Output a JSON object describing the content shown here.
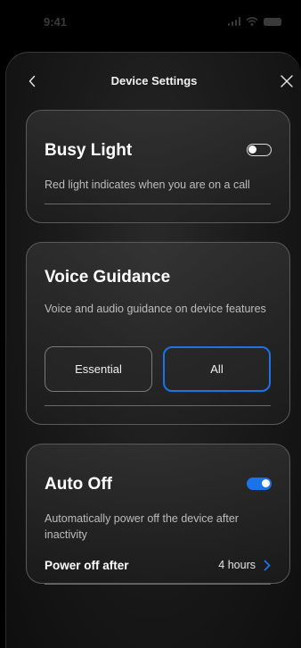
{
  "status_bar": {
    "time": "9:41"
  },
  "nav": {
    "title": "Device Settings"
  },
  "busy_light": {
    "title": "Busy Light",
    "description": "Red light indicates when you are on a call",
    "enabled": false
  },
  "voice_guidance": {
    "title": "Voice Guidance",
    "description": "Voice and audio guidance on device features",
    "options": [
      {
        "label": "Essential",
        "selected": false
      },
      {
        "label": "All",
        "selected": true
      }
    ]
  },
  "auto_off": {
    "title": "Auto Off",
    "description": "Automatically power off the device after inactivity",
    "enabled": true,
    "power_off_label": "Power off after",
    "power_off_value": "4 hours"
  },
  "colors": {
    "accent": "#1a73e8",
    "card_border": "#5a5a5a",
    "secondary_text": "#bdbdbd"
  },
  "icons": {
    "back": "chevron-left-icon",
    "close": "close-icon",
    "row_chevron": "chevron-right-icon"
  }
}
